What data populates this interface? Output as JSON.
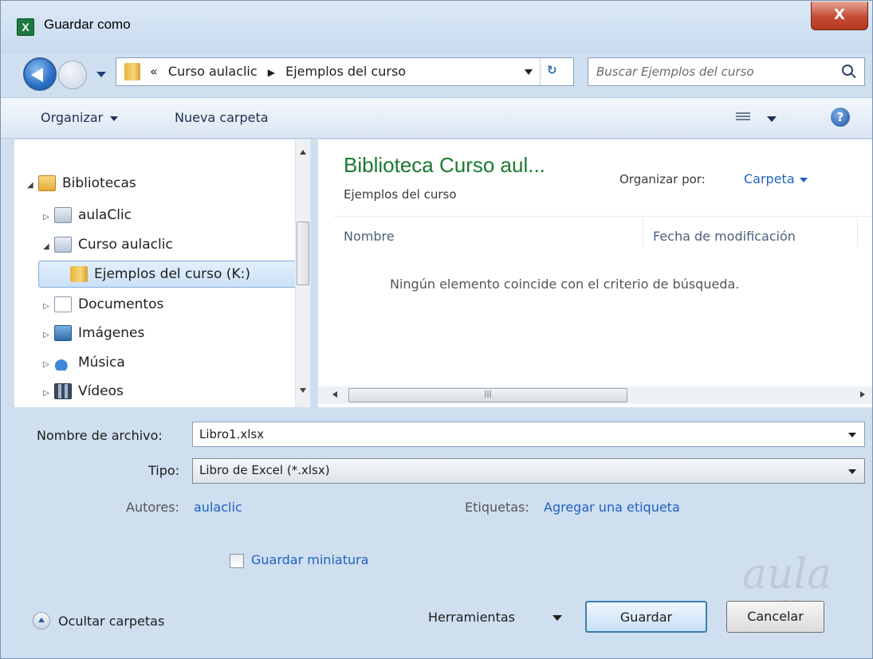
{
  "window": {
    "title": "Guardar como",
    "close_label": "X"
  },
  "navigation": {
    "breadcrumb": [
      "«",
      "Curso aulaclic",
      "Ejemplos del curso"
    ],
    "search_placeholder": "Buscar Ejemplos del curso"
  },
  "toolbar": {
    "organize": "Organizar",
    "new_folder": "Nueva carpeta"
  },
  "tree": {
    "items": [
      {
        "label": "Bibliotecas",
        "expanded": true
      },
      {
        "label": "aulaClic",
        "expanded": false
      },
      {
        "label": "Curso aulaclic",
        "expanded": true
      },
      {
        "label": "Ejemplos del curso (K:)",
        "selected": true
      },
      {
        "label": "Documentos",
        "expanded": false
      },
      {
        "label": "Imágenes",
        "expanded": false
      },
      {
        "label": "Música",
        "expanded": false
      },
      {
        "label": "Vídeos",
        "expanded": false
      }
    ]
  },
  "content": {
    "library_title": "Biblioteca Curso aul...",
    "library_subtitle": "Ejemplos del curso",
    "arrange_label": "Organizar por:",
    "arrange_value": "Carpeta",
    "columns": [
      "Nombre",
      "Fecha de modificación"
    ],
    "empty_message": "Ningún elemento coincide con el criterio de búsqueda."
  },
  "form": {
    "filename_label": "Nombre de archivo:",
    "filename_value": "Libro1.xlsx",
    "type_label": "Tipo:",
    "type_value": "Libro de Excel (*.xlsx)",
    "authors_label": "Autores:",
    "authors_value": "aulaclic",
    "tags_label": "Etiquetas:",
    "tags_value": "Agregar una etiqueta",
    "thumbnail_label": "Guardar miniatura"
  },
  "footer": {
    "hide_folders": "Ocultar carpetas",
    "tools": "Herramientas",
    "save": "Guardar",
    "cancel": "Cancelar"
  },
  "watermark": {
    "line1": "aula",
    "line2": "clic"
  },
  "colors": {
    "library_title": "#1a7a2e",
    "link": "#1e61c0"
  }
}
